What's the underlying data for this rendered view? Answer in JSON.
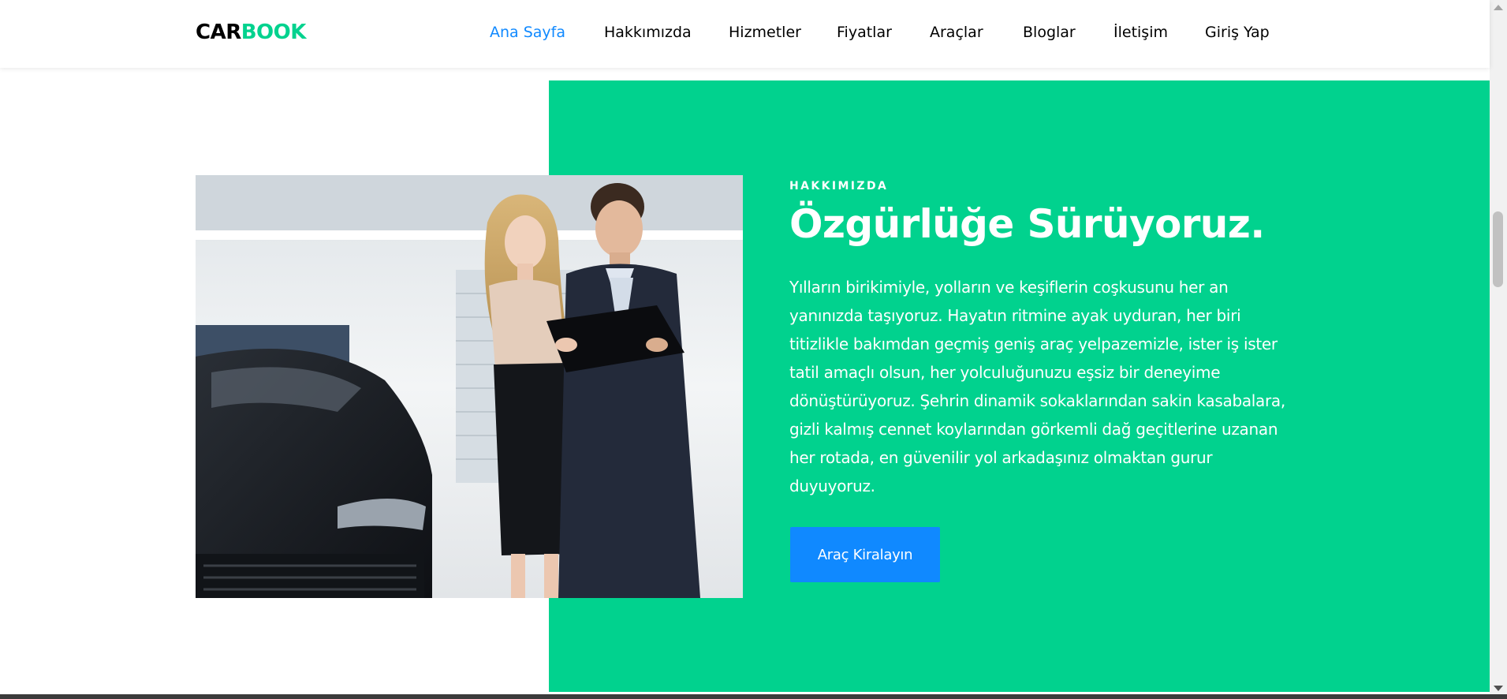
{
  "logo": {
    "part1": "CAR",
    "part2": "BOOK"
  },
  "nav": {
    "items": [
      {
        "label": "Ana Sayfa",
        "active": true
      },
      {
        "label": "Hakkımızda",
        "active": false
      },
      {
        "label": "Hizmetler",
        "active": false
      },
      {
        "label": "Fiyatlar",
        "active": false
      },
      {
        "label": "Araçlar",
        "active": false
      },
      {
        "label": "Bloglar",
        "active": false
      },
      {
        "label": "İletişim",
        "active": false
      },
      {
        "label": "Giriş Yap",
        "active": false
      }
    ]
  },
  "about": {
    "kicker": "HAKKIMIZDA",
    "headline": "Özgürlüğe Sürüyoruz.",
    "paragraph": "Yılların birikimiyle, yolların ve keşiflerin coşkusunu her an yanınızda taşıyoruz. Hayatın ritmine ayak uyduran, her biri titizlikle bakımdan geçmiş geniş araç yelpazemizle, ister iş ister tatil amaçlı olsun, her yolculuğunuzu eşsiz bir deneyime dönüştürüyoruz. Şehrin dinamik sokaklarından sakin kasabalara, gizli kalmış cennet koylarından görkemli dağ geçitlerine uzanan her rotada, en güvenilir yol arkadaşınız olmaktan gurur duyuyoruz.",
    "cta_label": "Araç Kiralayın"
  },
  "colors": {
    "accent_green": "#01d28e",
    "link_blue": "#1089ff",
    "text_dark": "#000000",
    "white": "#ffffff"
  },
  "icons": {
    "scroll_up": "triangle-up",
    "scroll_down": "triangle-down"
  }
}
